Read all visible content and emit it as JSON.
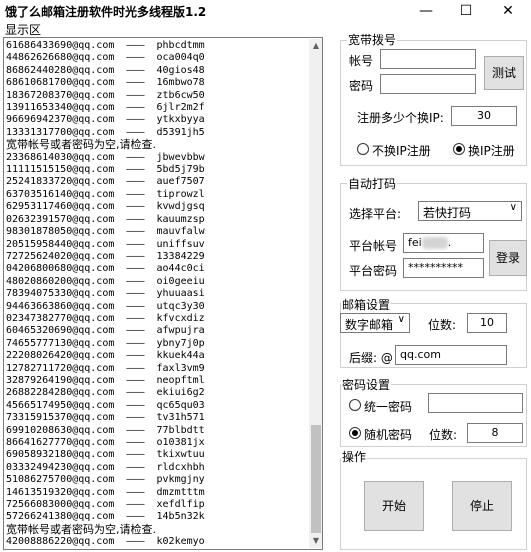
{
  "window": {
    "title": "饿了么邮箱注册软件时光多线程版1.2",
    "minimize": "—",
    "maximize": "☐",
    "close": "✕"
  },
  "log": {
    "label": "显示区",
    "lines": [
      "61686433690@qq.com  ———  phbcdtmm",
      "44862626680@qq.com  ———  oca004q0",
      "86862440280@qq.com  ———  40gios48",
      "68610681700@qq.com  ———  16mbwo78",
      "18367208370@qq.com  ———  ztb6cw50",
      "13911653340@qq.com  ———  6jlr2m2f",
      "96696942370@qq.com  ———  ytkxbyya",
      "13331317700@qq.com  ———  d5391jh5",
      "宽带帐号或者密码为空,请检查.",
      "23368614030@qq.com  ———  jbwevbbw",
      "11111515150@qq.com  ———  5bd5j79b",
      "25241833720@qq.com  ———  auef7507",
      "63703516140@qq.com  ———  tiprowzl",
      "62953117460@qq.com  ———  kvwdjgsq",
      "02632391570@qq.com  ———  kauumzsp",
      "98301878050@qq.com  ———  mauvfalw",
      "20515958440@qq.com  ———  uniffsuv",
      "72725624020@qq.com  ———  13384229",
      "04206800680@qq.com  ———  ao44c0ci",
      "48020860200@qq.com  ———  oi0geeiu",
      "78394075330@qq.com  ———  yhuuaasi",
      "94463663860@qq.com  ———  utqc3y30",
      "02347382770@qq.com  ———  kfvcxdiz",
      "60465320690@qq.com  ———  afwpujra",
      "74655777130@qq.com  ———  ybny7j0p",
      "22208026420@qq.com  ———  kkuek44a",
      "12782711720@qq.com  ———  faxl3vm9",
      "32879264190@qq.com  ———  neopftml",
      "26882284280@qq.com  ———  ekiui6g2",
      "45665174950@qq.com  ———  qc65qu03",
      "73315915370@qq.com  ———  tv31h571",
      "69910208630@qq.com  ———  77blbdtt",
      "86641627770@qq.com  ———  o10381jx",
      "69058932180@qq.com  ———  tkixwtuu",
      "03332494230@qq.com  ———  rldcxhbh",
      "51086275700@qq.com  ———  pvkmgjny",
      "14613519320@qq.com  ———  dmzmtttm",
      "72566083000@qq.com  ———  xefdlfip",
      "57266241380@qq.com  ———  14b5n32k",
      "宽带帐号或者密码为空,请检查.",
      "42008886220@qq.com  ———  k02kemyo"
    ]
  },
  "broadband": {
    "title": "宽带拨号",
    "account_label": "帐号",
    "password_label": "密码",
    "account_value": "",
    "password_value": "",
    "test_button": "测试",
    "per_ip_label": "注册多少个换IP:",
    "per_ip_value": "30",
    "radio_no_change": "不换IP注册",
    "radio_change": "换IP注册"
  },
  "captcha": {
    "title": "自动打码",
    "platform_label": "选择平台:",
    "platform_value": "若快打码",
    "account_label": "平台帐号",
    "account_value": "fei",
    "account_suffix": ".",
    "password_label": "平台密码",
    "password_value": "**********",
    "login_button": "登录"
  },
  "mailbox": {
    "title": "邮箱设置",
    "type_value": "数字邮箱",
    "digits_label": "位数:",
    "digits_value": "10",
    "suffix_label": "后缀: @",
    "suffix_value": "qq.com"
  },
  "pwd": {
    "title": "密码设置",
    "radio_fixed": "统一密码",
    "fixed_value": "",
    "radio_random": "随机密码",
    "digits_label": "位数:",
    "digits_value": "8"
  },
  "ops": {
    "title": "操作",
    "start_button": "开始",
    "stop_button": "停止"
  }
}
